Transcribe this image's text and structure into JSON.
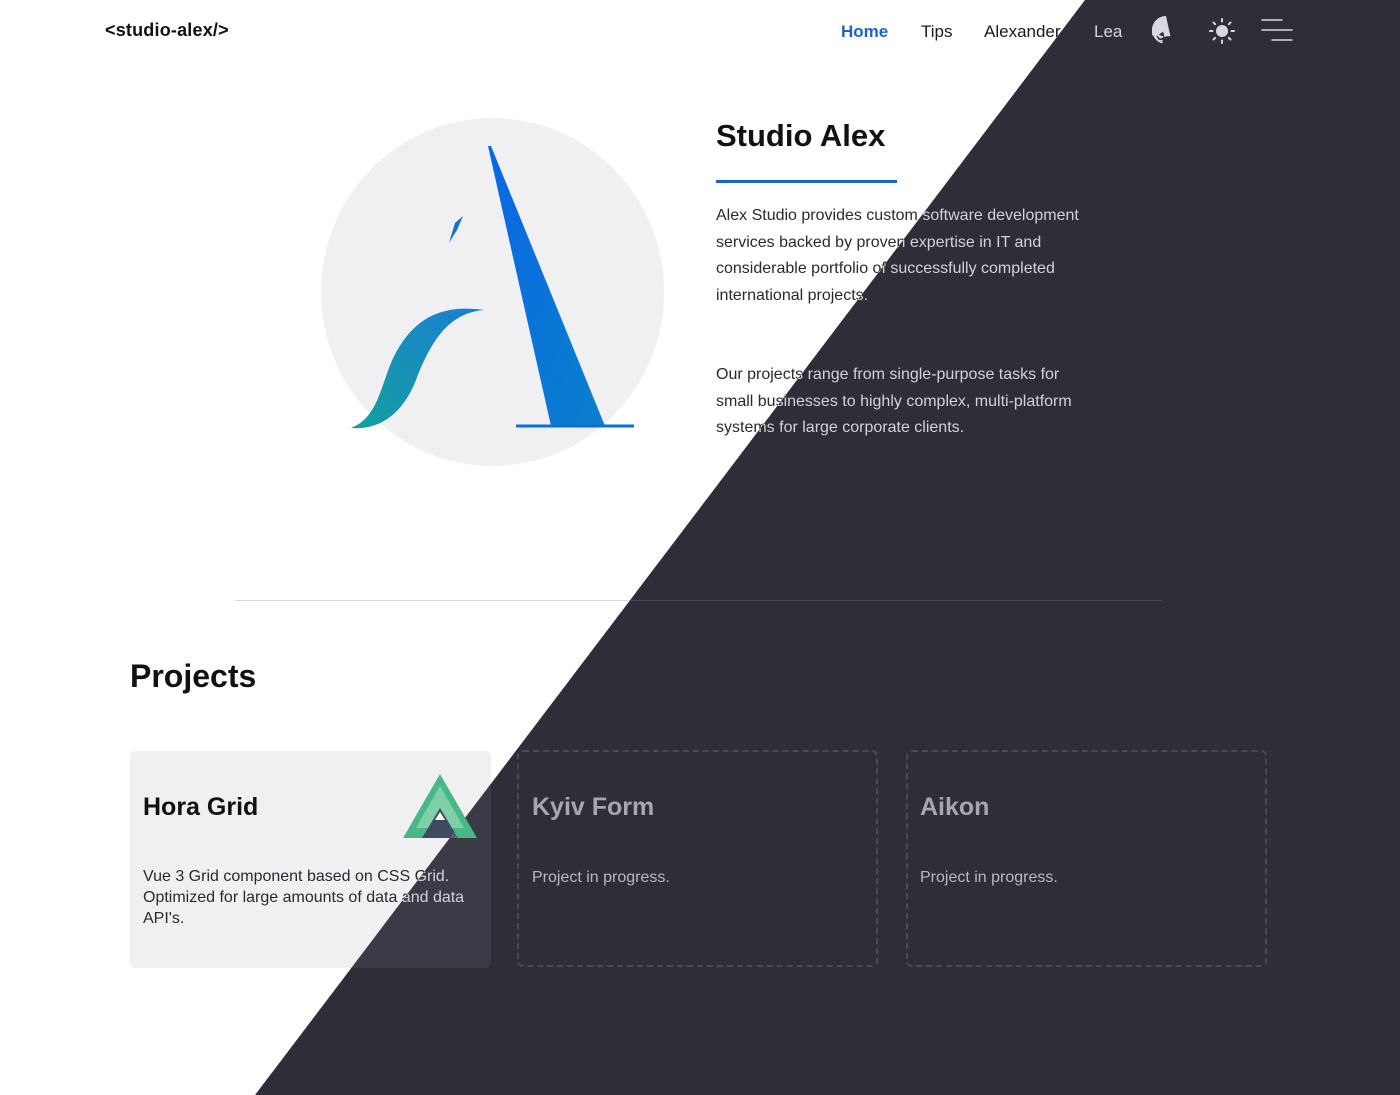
{
  "header": {
    "brand": "<studio-alex/>",
    "nav": [
      "Home",
      "Tips",
      "Alexander",
      "Lea"
    ],
    "active_nav": "Home",
    "icons": [
      "github-icon",
      "sun-icon",
      "menu-icon"
    ]
  },
  "hero": {
    "title": "Studio Alex",
    "paragraph_1": "Alex Studio provides custom software development services backed by proven expertise in IT and considerable portfolio of successfully completed international projects.",
    "paragraph_2": "Our projects range from single-purpose tasks for small businesses to highly complex, multi-platform systems for large corporate clients."
  },
  "projects": {
    "title": "Projects",
    "items": [
      {
        "name": "Hora Grid",
        "description": "Vue 3 Grid component based on CSS Grid. Optimized for large amounts of data and data API's.",
        "icon": "hora-grid-logo"
      },
      {
        "name": "Kyiv Form",
        "description": "Project in progress."
      },
      {
        "name": "Aikon",
        "description": "Project in progress."
      }
    ]
  },
  "colors": {
    "accent": "#1a64c8",
    "dark_background": "#2e2e38",
    "light_background": "#ffffff"
  }
}
